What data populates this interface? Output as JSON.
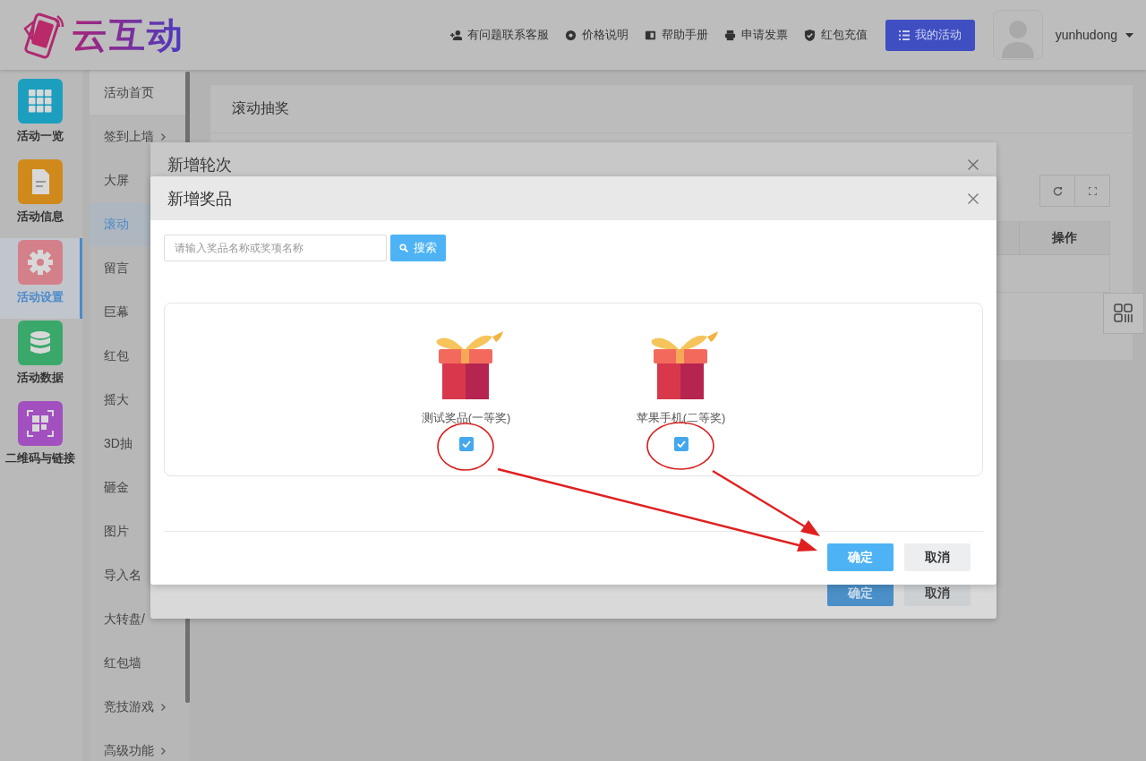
{
  "header": {
    "logo_text": "云互动",
    "links": [
      {
        "label": "有问题联系客服"
      },
      {
        "label": "价格说明"
      },
      {
        "label": "帮助手册"
      },
      {
        "label": "申请发票"
      },
      {
        "label": "红包充值"
      }
    ],
    "primary_button": "我的活动",
    "username": "yunhudong"
  },
  "nav": [
    {
      "label": "活动一览",
      "color": "#1c9fbf",
      "selected": false
    },
    {
      "label": "活动信息",
      "color": "#d08a1b",
      "selected": false
    },
    {
      "label": "活动设置",
      "color": "#d4808a",
      "selected": true
    },
    {
      "label": "活动数据",
      "color": "#3aa86a",
      "selected": false
    },
    {
      "label": "二维码与链接",
      "color": "#a24fc0",
      "selected": false
    }
  ],
  "subnav": [
    {
      "label": "活动首页",
      "selected": false,
      "expandable": false
    },
    {
      "label": "签到上墙",
      "selected": false,
      "expandable": true
    },
    {
      "label": "大屏",
      "selected": false,
      "expandable": false
    },
    {
      "label": "滚动",
      "selected": true,
      "expandable": false
    },
    {
      "label": "留言",
      "selected": false,
      "expandable": false
    },
    {
      "label": "巨幕",
      "selected": false,
      "expandable": false
    },
    {
      "label": "红包",
      "selected": false,
      "expandable": false
    },
    {
      "label": "摇大",
      "selected": false,
      "expandable": false
    },
    {
      "label": "3D抽",
      "selected": false,
      "expandable": false
    },
    {
      "label": "砸金",
      "selected": false,
      "expandable": false
    },
    {
      "label": "图片",
      "selected": false,
      "expandable": false
    },
    {
      "label": "导入名",
      "selected": false,
      "expandable": false
    },
    {
      "label": "大转盘/",
      "selected": false,
      "expandable": false
    },
    {
      "label": "红包墙",
      "selected": false,
      "expandable": false
    },
    {
      "label": "竞技游戏",
      "selected": false,
      "expandable": true
    },
    {
      "label": "高级功能",
      "selected": false,
      "expandable": true
    }
  ],
  "page": {
    "title": "滚动抽奖",
    "table_columns": [
      "操作"
    ]
  },
  "dialog_back": {
    "title": "新增轮次",
    "buttons": [
      {
        "label": "确定",
        "kind": "primary"
      },
      {
        "label": "取消",
        "kind": "default"
      }
    ]
  },
  "dialog": {
    "title": "新增奖品",
    "search": {
      "placeholder": "请输入奖品名称或奖项名称",
      "button": "搜索"
    },
    "prizes": [
      {
        "name": "测试奖品(一等奖)",
        "checked": true
      },
      {
        "name": "苹果手机(二等奖)",
        "checked": true
      }
    ],
    "buttons": [
      {
        "label": "确定",
        "kind": "primary"
      },
      {
        "label": "取消",
        "kind": "default"
      }
    ]
  }
}
